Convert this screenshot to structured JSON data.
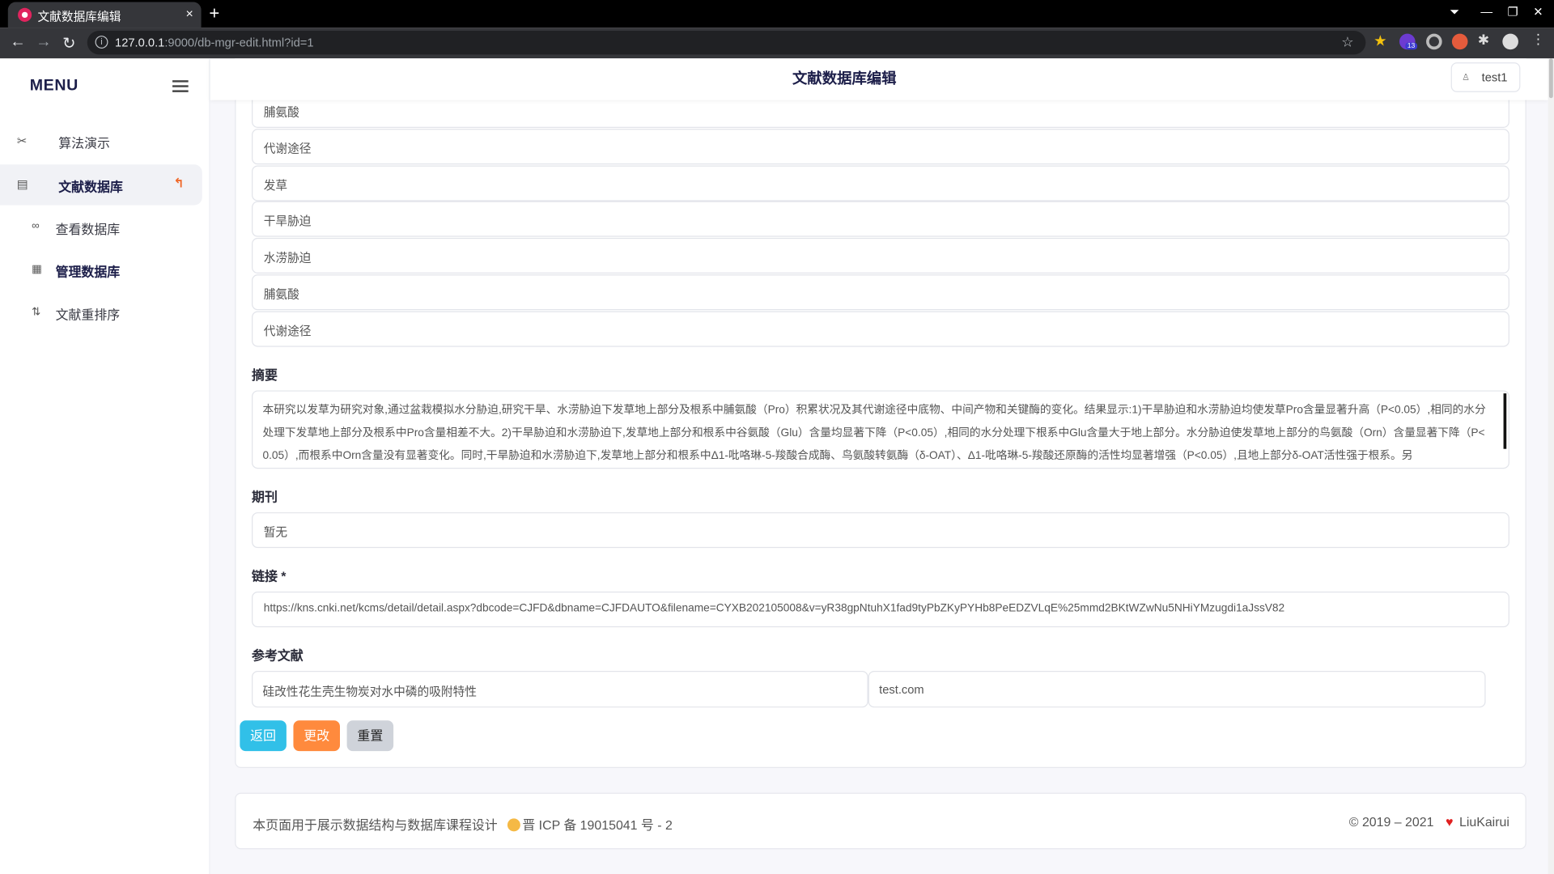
{
  "browser": {
    "tab_title": "文献数据库编辑",
    "close_glyph": "×",
    "newtab_glyph": "+",
    "url_host": "127.0.0.1",
    "url_rest": ":9000/db-mgr-edit.html?id=1",
    "ext_badge": "13"
  },
  "sidebar": {
    "menu_title": "MENU",
    "items": [
      {
        "label": "算法演示",
        "icon": "tools-icon"
      },
      {
        "label": "文献数据库",
        "icon": "table-icon",
        "active": true
      }
    ],
    "subitems": [
      {
        "label": "查看数据库",
        "icon": "glasses-icon"
      },
      {
        "label": "管理数据库",
        "icon": "calendar-icon"
      },
      {
        "label": "文献重排序",
        "icon": "sort-icon"
      }
    ]
  },
  "header": {
    "title": "文献数据库编辑",
    "username": "test1"
  },
  "keywords": [
    "脯氨酸",
    "代谢途径",
    "发草",
    "干旱胁迫",
    "水涝胁迫",
    "脯氨酸",
    "代谢途径"
  ],
  "form": {
    "abstract_label": "摘要",
    "abstract": "本研究以发草为研究对象,通过盆栽模拟水分胁迫,研究干旱、水涝胁迫下发草地上部分及根系中脯氨酸（Pro）积累状况及其代谢途径中底物、中间产物和关键酶的变化。结果显示:1)干旱胁迫和水涝胁迫均使发草Pro含量显著升高（P<0.05）,相同的水分处理下发草地上部分及根系中Pro含量相差不大。2)干旱胁迫和水涝胁迫下,发草地上部分和根系中谷氨酸（Glu）含量均显著下降（P<0.05）,相同的水分处理下根系中Glu含量大于地上部分。水分胁迫使发草地上部分的鸟氨酸（Orn）含量显著下降（P<0.05）,而根系中Orn含量没有显著变化。同时,干旱胁迫和水涝胁迫下,发草地上部分和根系中Δ1-吡咯琳-5-羧酸合成酶、鸟氨酸转氨酶（δ-OAT）、Δ1-吡咯琳-5-羧酸还原酶的活性均显著增强（P<0.05）,且地上部分δ-OAT活性强于根系。另",
    "journal_label": "期刊",
    "journal": "暂无",
    "link_label": "链接 *",
    "link": "https://kns.cnki.net/kcms/detail/detail.aspx?dbcode=CJFD&dbname=CJFDAUTO&filename=CYXB202105008&v=yR38gpNtuhX1fad9tyPbZKyPYHb8PeEDZVLqE%25mmd2BKtWZwNu5NHiYMzugdi1aJssV82",
    "ref_label": "参考文献",
    "ref_title": "硅改性花生壳生物炭对水中磷的吸附特性",
    "ref_url": "test.com"
  },
  "buttons": {
    "back": "返回",
    "edit": "更改",
    "reset": "重置"
  },
  "footer": {
    "left_text": "本页面用于展示数据结构与数据库课程设计",
    "icp": "晋 ICP 备 19015041 号 - 2",
    "copyright": "© 2019 – 2021",
    "author": "LiuKairui"
  }
}
